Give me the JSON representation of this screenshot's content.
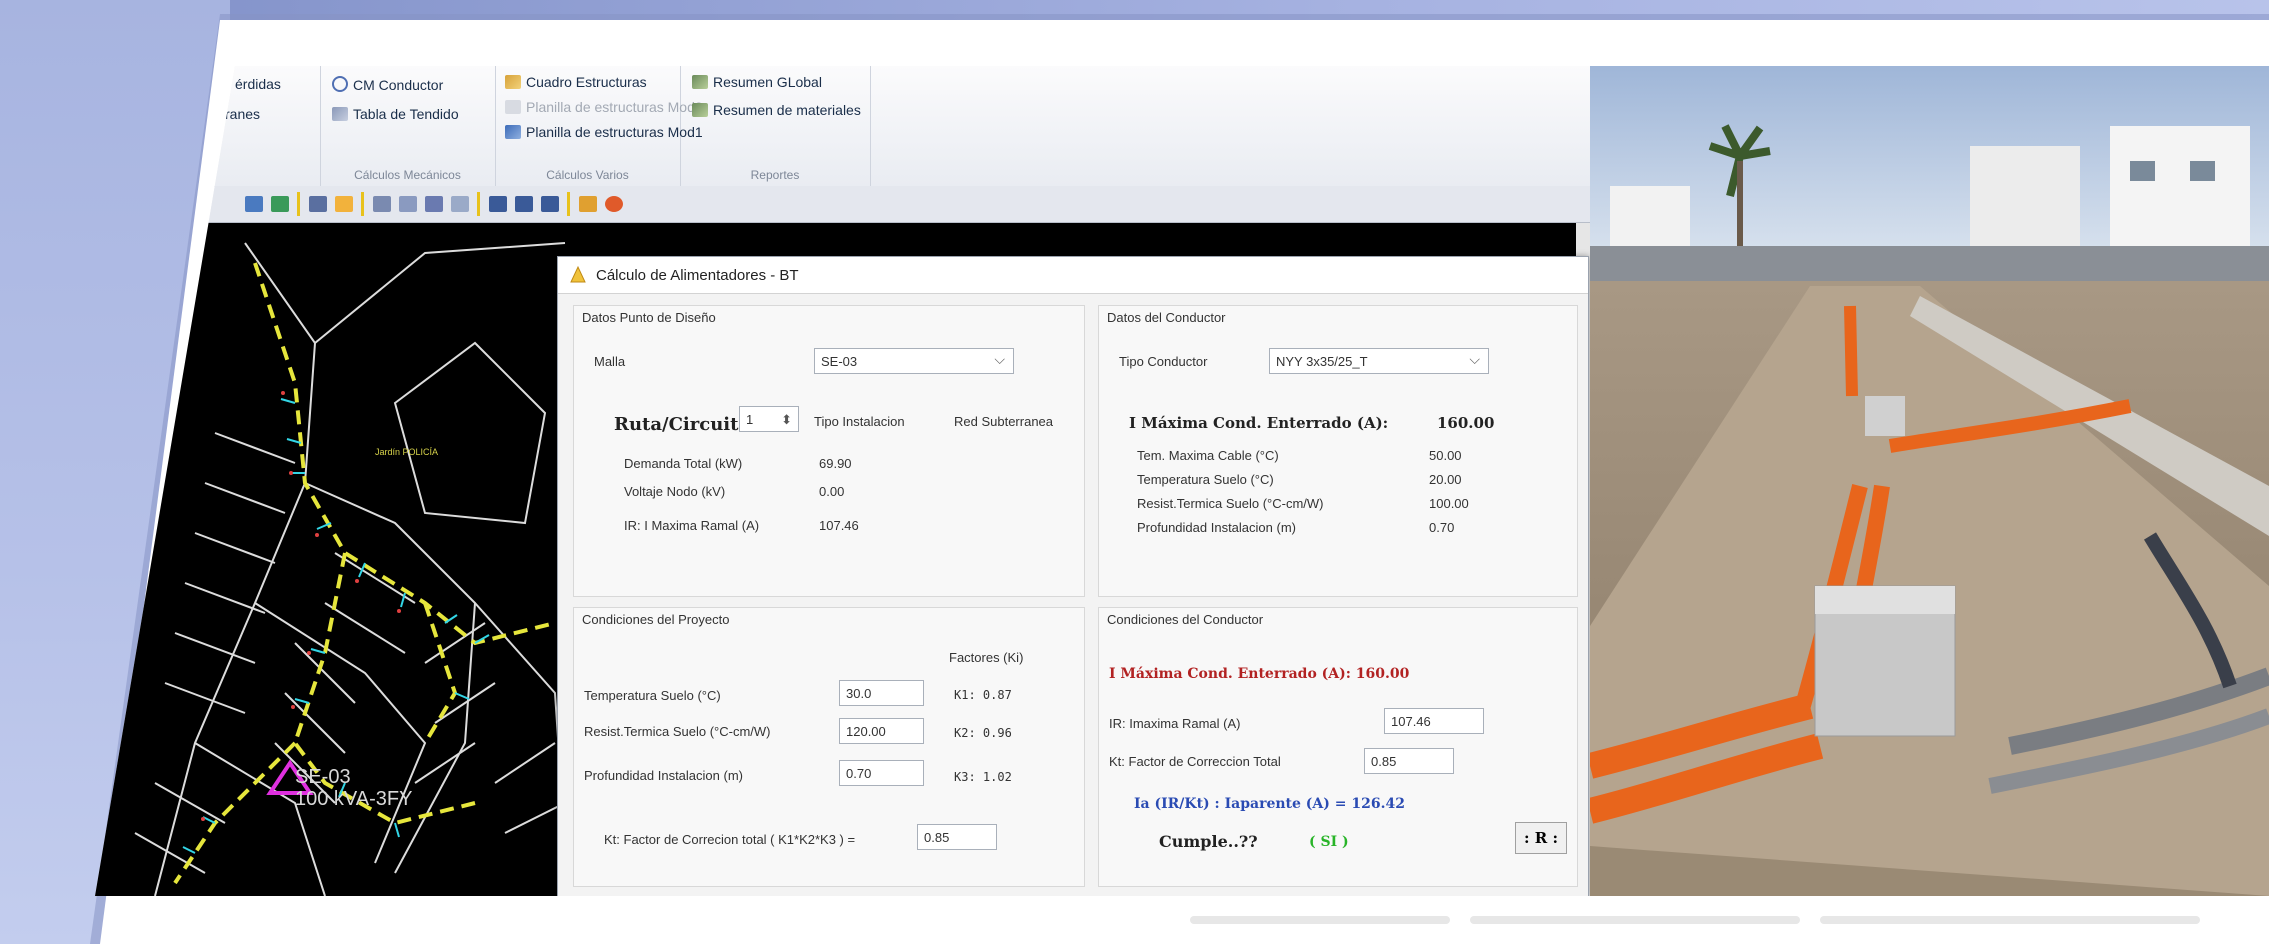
{
  "ribbon": {
    "groups": [
      {
        "items": [
          "érdidas",
          "ranes"
        ],
        "caption": ""
      },
      {
        "items": [
          "CM Conductor",
          "Tabla de Tendido"
        ],
        "caption": "Cálculos Mecánicos"
      },
      {
        "items": [
          "Cuadro Estructuras",
          "Planilla de estructuras Mod2",
          "Planilla de estructuras Mod1"
        ],
        "caption": "Cálculos Varios"
      },
      {
        "items": [
          "Resumen GLobal",
          "Resumen de materiales"
        ],
        "caption": "Reportes"
      }
    ]
  },
  "cad": {
    "label_se": "SE-03",
    "label_kva": "100 kVA-3FY",
    "street_label": "Jardín POLICÍA"
  },
  "dialog": {
    "title": "Cálculo de Alimentadores - BT",
    "punto": {
      "group_label": "Datos Punto de Diseño",
      "malla_label": "Malla",
      "malla_value": "SE-03",
      "ruta_label": "Ruta/Circuito",
      "ruta_value": "1",
      "tipo_label": "Tipo Instalacion",
      "tipo_value": "Red Subterranea",
      "demanda_label": "Demanda Total (kW)",
      "demanda_value": "69.90",
      "voltaje_label": "Voltaje Nodo (kV)",
      "voltaje_value": "0.00",
      "ir_label": "IR: I Maxima Ramal (A)",
      "ir_value": "107.46"
    },
    "conductor": {
      "group_label": "Datos del Conductor",
      "tipo_label": "Tipo Conductor",
      "tipo_value": "NYY 3x35/25_T",
      "imax_label": "I Máxima Cond. Enterrado (A):",
      "imax_value": "160.00",
      "rows": [
        {
          "label": "Tem. Maxima Cable (°C)",
          "value": "50.00"
        },
        {
          "label": "Temperatura Suelo (°C)",
          "value": "20.00"
        },
        {
          "label": "Resist.Termica Suelo (°C-cm/W)",
          "value": "100.00"
        },
        {
          "label": "Profundidad Instalacion (m)",
          "value": "0.70"
        }
      ]
    },
    "proyecto": {
      "group_label": "Condiciones del Proyecto",
      "factores_label": "Factores (Ki)",
      "rows": [
        {
          "label": "Temperatura Suelo (°C)",
          "value": "30.0",
          "factor": "K1: 0.87"
        },
        {
          "label": "Resist.Termica Suelo (°C-cm/W)",
          "value": "120.00",
          "factor": "K2: 0.96"
        },
        {
          "label": "Profundidad Instalacion (m)",
          "value": "0.70",
          "factor": "K3: 1.02"
        }
      ],
      "kt_label": "Kt: Factor de Correcion total ( K1*K2*K3 ) =",
      "kt_value": "0.85"
    },
    "condiciones": {
      "group_label": "Condiciones del Conductor",
      "imax_text": "I Máxima Cond. Enterrado (A): 160.00",
      "ir_label": "IR: Imaxima Ramal (A)",
      "ir_value": "107.46",
      "kt_label": "Kt: Factor de Correccion Total",
      "kt_value": "0.85",
      "ia_text": "Ia (IR/Kt) : Iaparente (A) = 126.42",
      "cumple_label": "Cumple..??",
      "cumple_value": "( SI )",
      "r_button": ": R :"
    }
  },
  "colors": {
    "cad_yellow": "#e6e63c",
    "cad_cyan": "#33d6e6",
    "pipe_orange": "#e8651c",
    "magenta": "#e030e0"
  }
}
